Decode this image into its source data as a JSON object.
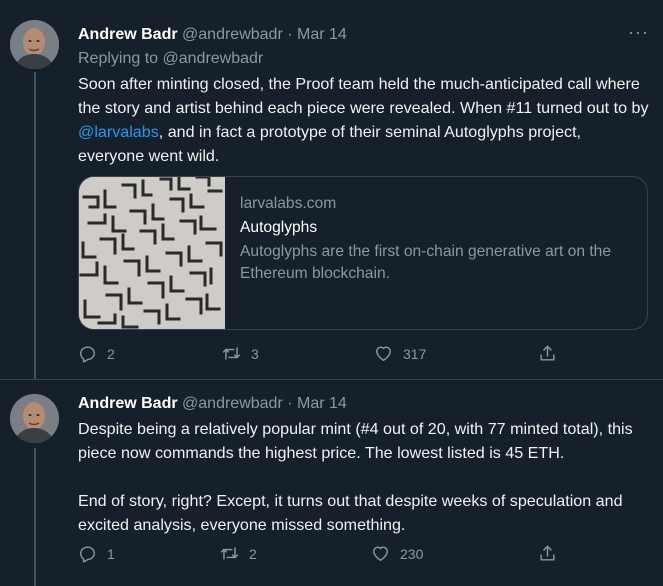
{
  "tweets": [
    {
      "author": "Andrew Badr",
      "handle": "@andrewbadr",
      "separator": "·",
      "date": "Mar 14",
      "more": "···",
      "replying_prefix": "Replying to",
      "replying_handle": "@andrewbadr",
      "text_before": "Soon after minting closed, the Proof team held the much-anticipated call where the story and artist behind each piece were revealed. When #11 turned out to by ",
      "mention": "@larvalabs",
      "text_after": ", and in fact a prototype of their seminal Autoglyphs project, everyone went wild.",
      "card": {
        "domain": "larvalabs.com",
        "title": "Autoglyphs",
        "description": "Autoglyphs are the first on-chain generative art on the Ethereum blockchain."
      },
      "replies": "2",
      "retweets": "3",
      "likes": "317"
    },
    {
      "author": "Andrew Badr",
      "handle": "@andrewbadr",
      "separator": "·",
      "date": "Mar 14",
      "paragraph1": "Despite being a relatively popular mint (#4 out of 20, with 77 minted total), this piece now commands the highest price. The lowest listed is 45 ETH.",
      "paragraph2": "End of story, right? Except, it turns out that despite weeks of speculation and excited analysis, everyone missed something.",
      "replies": "1",
      "retweets": "2",
      "likes": "230"
    }
  ],
  "colors": {
    "background": "#15202b",
    "border": "#38444d",
    "link": "#1d9bf0",
    "muted": "#8899a6"
  }
}
